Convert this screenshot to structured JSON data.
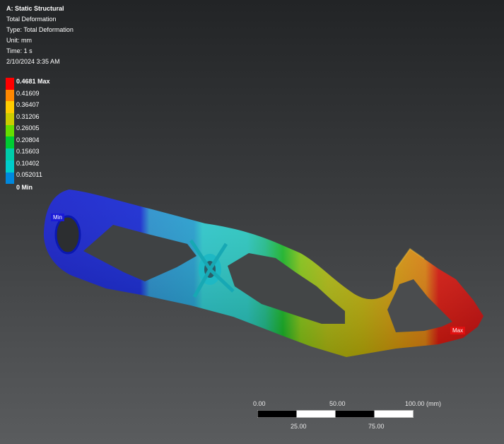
{
  "info": {
    "title": "A: Static Structural",
    "result": "Total Deformation",
    "type": "Type: Total Deformation",
    "unit": "Unit: mm",
    "time": "Time: 1 s",
    "date": "2/10/2024 3:35 AM"
  },
  "legend": {
    "labels": [
      "0.4681 Max",
      "0.41609",
      "0.36407",
      "0.31206",
      "0.26005",
      "0.20804",
      "0.15603",
      "0.10402",
      "0.052011",
      "0 Min"
    ],
    "colors": [
      "#ff0000",
      "#ff8800",
      "#ffcc00",
      "#cccc00",
      "#66dd00",
      "#00cc33",
      "#00ccaa",
      "#00cccc",
      "#0088dd",
      "#0000ee"
    ]
  },
  "tags": {
    "min": "Min",
    "max": "Max"
  },
  "scale": {
    "top": [
      "0.00",
      "50.00",
      "100.00 (mm)"
    ],
    "bottom": [
      "25.00",
      "75.00"
    ]
  }
}
